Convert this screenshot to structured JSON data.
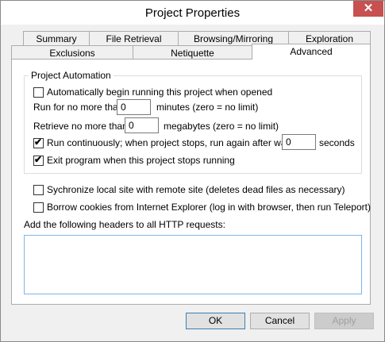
{
  "window": {
    "title": "Project Properties",
    "close_glyph": "✕"
  },
  "tabs_row1": [
    "Summary",
    "File Retrieval",
    "Browsing/Mirroring",
    "Exploration"
  ],
  "tabs_row2": [
    "Exclusions",
    "Netiquette",
    "Advanced"
  ],
  "active_tab": "Advanced",
  "automation": {
    "group_title": "Project Automation",
    "auto_begin": {
      "label": "Automatically begin running this project when opened",
      "checked": false
    },
    "run_limit_prefix": "Run for no more than",
    "run_limit_value": "0",
    "run_limit_suffix": "minutes (zero = no limit)",
    "retrieve_prefix": "Retrieve no more than",
    "retrieve_value": "0",
    "retrieve_suffix": "megabytes (zero = no limit)",
    "run_continuously": {
      "label": "Run continuously; when project stops, run again after waiting",
      "checked": true
    },
    "wait_value": "0",
    "wait_suffix": "seconds",
    "exit_program": {
      "label": "Exit program when this project stops running",
      "checked": true
    }
  },
  "sync": {
    "label": "Sychronize local site with remote site (deletes dead files as necessary)",
    "checked": false
  },
  "cookies": {
    "label": "Borrow cookies from Internet Explorer (log in with browser, then run Teleport)",
    "checked": false
  },
  "headers_label": "Add the following headers to all HTTP requests:",
  "headers_value": "",
  "buttons": {
    "ok": "OK",
    "cancel": "Cancel",
    "apply": "Apply"
  },
  "check_glyph": "✔"
}
